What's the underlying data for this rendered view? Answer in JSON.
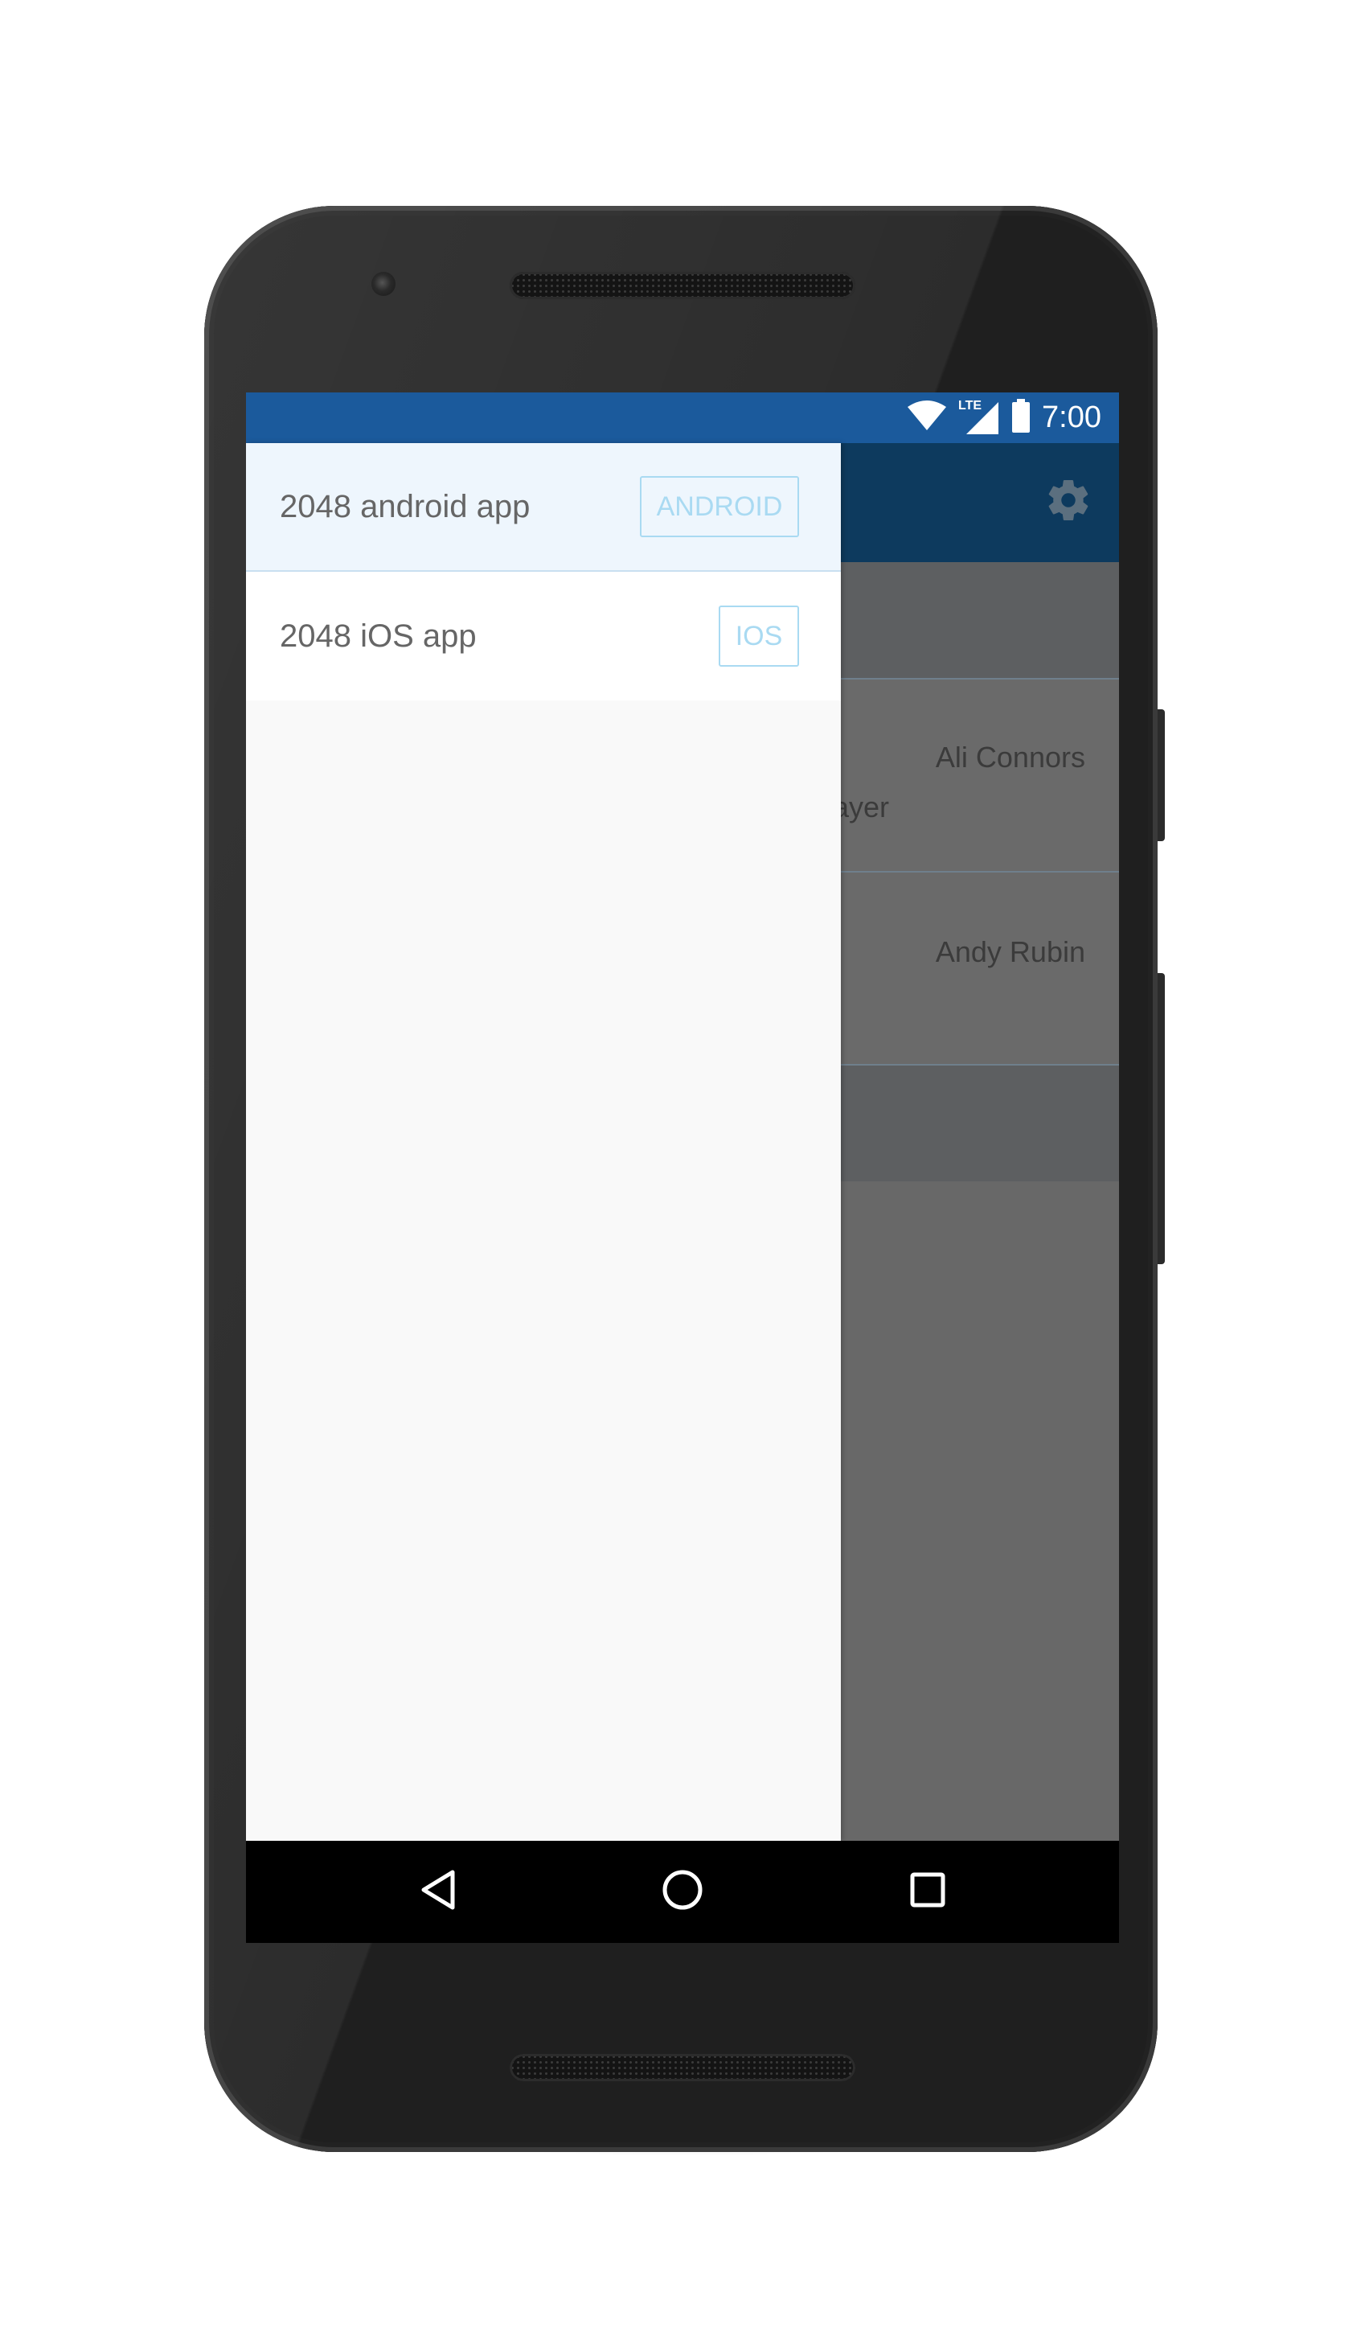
{
  "status_bar": {
    "network": "LTE",
    "time": "7:00"
  },
  "app_bar": {
    "settings_icon": "gear-icon"
  },
  "list": {
    "items": [
      {
        "name": "Ali Connors",
        "subtitle_fragment": "layer"
      },
      {
        "name": "Andy Rubin"
      }
    ]
  },
  "drawer": {
    "items": [
      {
        "label": "2048 android app",
        "tag": "ANDROID",
        "selected": true
      },
      {
        "label": "2048 iOS app",
        "tag": "IOS",
        "selected": false
      }
    ]
  },
  "nav_bar": {
    "back_icon": "back-triangle-icon",
    "home_icon": "home-circle-icon",
    "recents_icon": "recents-square-icon"
  },
  "colors": {
    "status_bar": "#1b5a9c",
    "app_bar": "#0d3a5e",
    "tag_border": "#a9daf2",
    "selected_item_bg": "#eef6fd"
  }
}
